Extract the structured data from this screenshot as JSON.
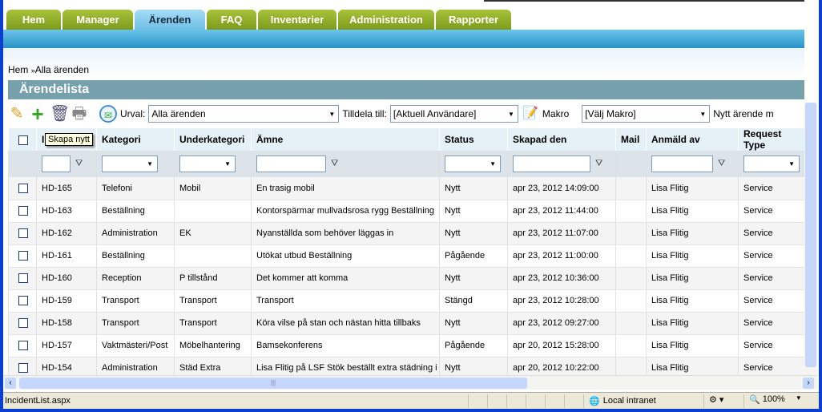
{
  "tabs": [
    {
      "label": "Hem",
      "active": false
    },
    {
      "label": "Manager",
      "active": false
    },
    {
      "label": "Ärenden",
      "active": true
    },
    {
      "label": "FAQ",
      "active": false
    },
    {
      "label": "Inventarier",
      "active": false
    },
    {
      "label": "Administration",
      "active": false
    },
    {
      "label": "Rapporter",
      "active": false
    }
  ],
  "breadcrumb": {
    "home": "Hem",
    "sep": "»",
    "current": "Alla ärenden"
  },
  "title": "Ärendelista",
  "toolbar": {
    "urval_label": "Urval:",
    "urval_value": "Alla ärenden",
    "tilldela_label": "Tilldela till:",
    "tilldela_value": "[Aktuell Användare]",
    "makro_label": "Makro",
    "makro_value": "[Välj Makro]",
    "nytt_label": "Nytt ärende m"
  },
  "tooltip": "Skapa nytt",
  "columns": [
    "ID",
    "Kategori",
    "Underkategori",
    "Ämne",
    "Status",
    "Skapad den",
    "Mail",
    "Anmäld av",
    "Request Type"
  ],
  "rows": [
    [
      "HD-165",
      "Telefoni",
      "Mobil",
      "En trasig mobil",
      "Nytt",
      "apr 23, 2012 14:09:00",
      "",
      "Lisa Flitig",
      "Service"
    ],
    [
      "HD-163",
      "Beställning",
      "",
      "Kontorspärmar mullvadsrosa rygg Beställning",
      "Nytt",
      "apr 23, 2012 11:44:00",
      "",
      "Lisa Flitig",
      "Service"
    ],
    [
      "HD-162",
      "Administration",
      "EK",
      "Nyanställda som behöver läggas in",
      "Nytt",
      "apr 23, 2012 11:07:00",
      "",
      "Lisa Flitig",
      "Service"
    ],
    [
      "HD-161",
      "Beställning",
      "",
      "Utökat utbud Beställning",
      "Pågående",
      "apr 23, 2012 11:00:00",
      "",
      "Lisa Flitig",
      "Service"
    ],
    [
      "HD-160",
      "Reception",
      "P tillstånd",
      "Det kommer att komma",
      "Nytt",
      "apr 23, 2012 10:36:00",
      "",
      "Lisa Flitig",
      "Service"
    ],
    [
      "HD-159",
      "Transport",
      "Transport",
      "Transport",
      "Stängd",
      "apr 23, 2012 10:28:00",
      "",
      "Lisa Flitig",
      "Service"
    ],
    [
      "HD-158",
      "Transport",
      "Transport",
      "Köra vilse på stan och nästan hitta tillbaks",
      "Nytt",
      "apr 23, 2012 09:27:00",
      "",
      "Lisa Flitig",
      "Service"
    ],
    [
      "HD-157",
      "Vaktmästeri/Post",
      "Möbelhantering",
      "Bamsekonferens",
      "Pågående",
      "apr 20, 2012 15:28:00",
      "",
      "Lisa Flitig",
      "Service"
    ],
    [
      "HD-154",
      "Administration",
      "Städ Extra",
      "Lisa Flitig på LSF Stök beställt extra städning i",
      "Nytt",
      "apr 20, 2012 10:22:00",
      "",
      "Lisa Flitig",
      "Service"
    ]
  ],
  "statusbar": {
    "url": "IncidentList.aspx",
    "zone": "Local intranet",
    "zoom": "100%"
  },
  "colors": {
    "tab_green": "#8fae28",
    "tab_active": "#8fd0ee",
    "title_bar": "#76a0ac",
    "blue_bar": "#2a93c8"
  }
}
